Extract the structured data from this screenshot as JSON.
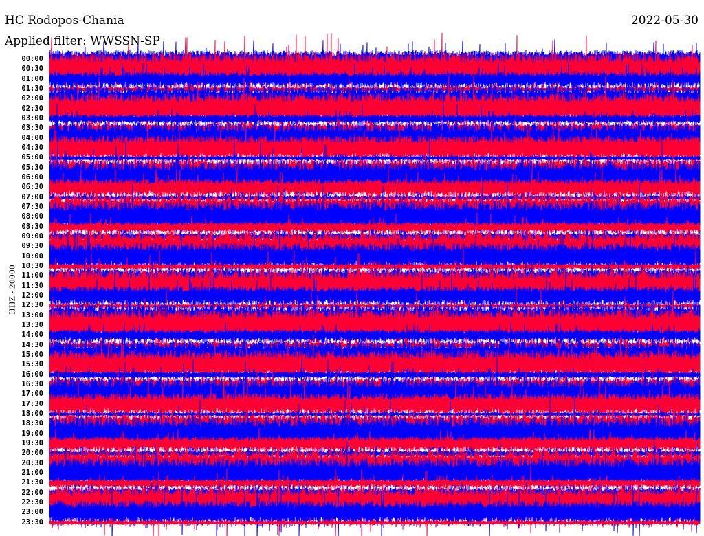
{
  "chart_data": {
    "type": "line",
    "title": "HC Rodopos-Chania",
    "subtitle": "Applied filter: WWSSN-SP",
    "date": "2022-05-30",
    "ylabel": "HHZ - 20000",
    "trace_colors": [
      "#0000ff",
      "#ff0033"
    ],
    "row_labels": [
      "00:00",
      "00:30",
      "01:00",
      "01:30",
      "02:00",
      "02:30",
      "03:00",
      "03:30",
      "04:00",
      "04:30",
      "05:00",
      "05:30",
      "06:00",
      "06:30",
      "07:00",
      "07:30",
      "08:00",
      "08:30",
      "09:00",
      "09:30",
      "10:00",
      "10:30",
      "11:00",
      "11:30",
      "12:00",
      "12:30",
      "13:00",
      "13:30",
      "14:00",
      "14:30",
      "15:00",
      "15:30",
      "16:00",
      "16:30",
      "17:00",
      "17:30",
      "18:00",
      "18:30",
      "19:00",
      "19:30",
      "20:00",
      "20:30",
      "21:00",
      "21:30",
      "22:00",
      "22:30",
      "23:00",
      "23:30"
    ]
  }
}
